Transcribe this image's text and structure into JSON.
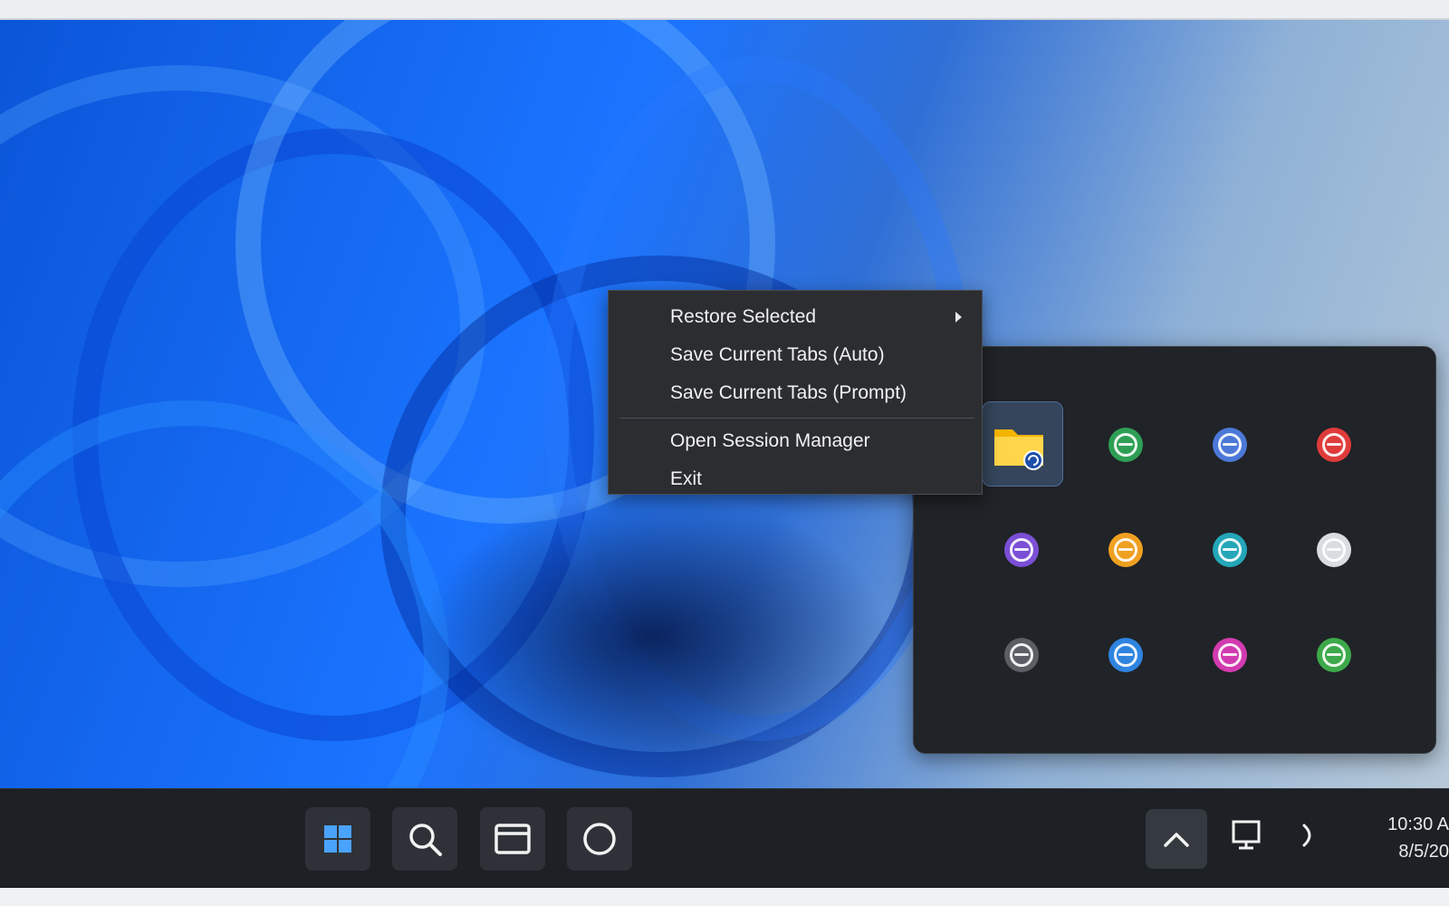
{
  "context_menu": {
    "items": [
      {
        "label": "Restore Selected",
        "has_submenu": true
      },
      {
        "label": "Save Current Tabs (Auto)",
        "has_submenu": false
      },
      {
        "label": "Save Current Tabs (Prompt)",
        "has_submenu": false
      },
      {
        "label": "Open Session Manager",
        "has_submenu": false
      },
      {
        "label": "Exit",
        "has_submenu": false
      }
    ]
  },
  "tray_flyout": {
    "icons": [
      {
        "name": "session-folder-icon",
        "color": "#f5c518",
        "selected": true
      },
      {
        "name": "green-app-icon",
        "color": "#2e9f55"
      },
      {
        "name": "blue-app-icon",
        "color": "#4c78d8"
      },
      {
        "name": "red-app-icon",
        "color": "#e03b3b"
      },
      {
        "name": "purple-app-icon",
        "color": "#7b4fd6"
      },
      {
        "name": "orange-app-icon",
        "color": "#f0a020"
      },
      {
        "name": "teal-app-icon",
        "color": "#23a7b8"
      },
      {
        "name": "white-app-icon",
        "color": "#d9dce0"
      },
      {
        "name": "gray-app-icon",
        "color": "#5b5f65"
      },
      {
        "name": "azure-app-icon",
        "color": "#2f84e0"
      },
      {
        "name": "magenta-app-icon",
        "color": "#d23bb0"
      },
      {
        "name": "lime-green-app-icon",
        "color": "#3da94a"
      }
    ]
  },
  "taskbar": {
    "buttons": [
      "start-icon",
      "search-icon",
      "task-view-icon",
      "cortana-icon"
    ],
    "tray": [
      "chevron-up-icon",
      "display-icon",
      "volume-icon"
    ],
    "clock_time": "10:30 A",
    "clock_date": "8/5/20"
  },
  "colors": {
    "accent": "#0b55d8",
    "taskbar": "#1d2025",
    "menu_bg": "#2b2d31",
    "flyout_bg": "#202327"
  }
}
